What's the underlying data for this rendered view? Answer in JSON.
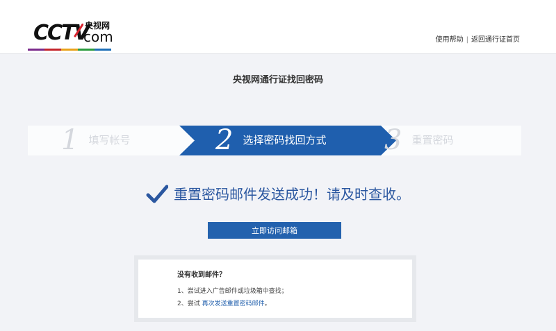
{
  "header": {
    "logo": {
      "text": "CCTV",
      "cn": "央视网",
      "com": "com",
      "bar_colors": [
        "#7b2a8c",
        "#c4242a",
        "#e8a21a",
        "#2a9b3e",
        "#1e6fb7"
      ]
    },
    "links": {
      "help": "使用帮助",
      "separator": "|",
      "back": "返回通行证首页"
    }
  },
  "page_title": "央视网通行证找回密码",
  "steps": [
    {
      "number": "1",
      "label": "填写帐号"
    },
    {
      "number": "2",
      "label": "选择密码找回方式"
    },
    {
      "number": "3",
      "label": "重置密码"
    }
  ],
  "success": {
    "icon": "check-icon",
    "message": "重置密码邮件发送成功！请及时查收。"
  },
  "visit_button": "立即访问邮箱",
  "help": {
    "title": "没有收到邮件？",
    "line1": "1、尝试进入广告邮件或垃圾箱中查找；",
    "line2_prefix": "2、尝试 ",
    "line2_link": "再次发送重置密码邮件",
    "line2_suffix": "。"
  },
  "colors": {
    "accent": "#2462ae",
    "step_active": "#1f5fae",
    "success_text": "#2b57a0",
    "background": "#f2f3f7"
  }
}
